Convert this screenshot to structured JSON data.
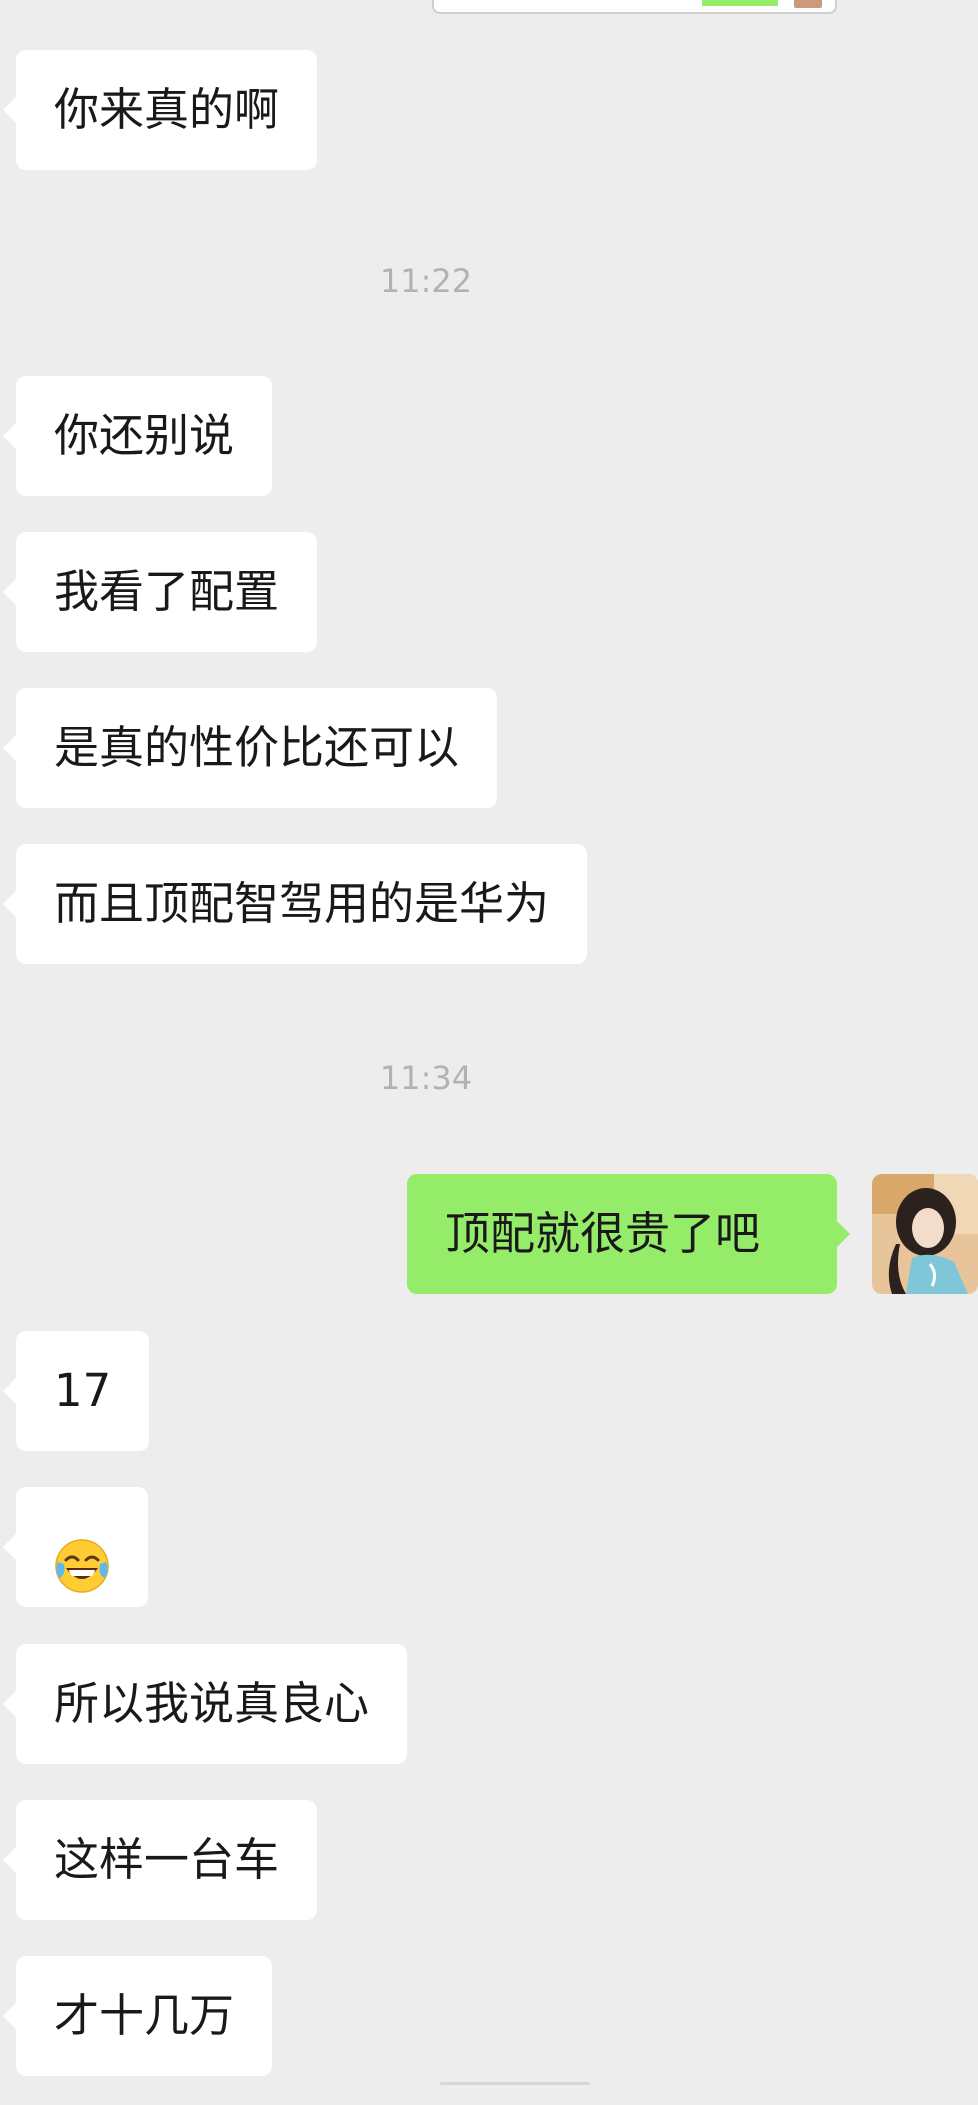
{
  "messages": {
    "m1": "你来真的啊",
    "time1": "11:22",
    "m2": "你还别说",
    "m3": "我看了配置",
    "m4": "是真的性价比还可以",
    "m5": "而且顶配智驾用的是华为",
    "time2": "11:34",
    "m6": "顶配就很贵了吧",
    "m7": "17",
    "m8_emoji": "tears-of-joy-emoji",
    "m9": "所以我说真良心",
    "m10": "这样一台车",
    "m11": "才十几万"
  },
  "colors": {
    "background": "#ededed",
    "incoming_bubble": "#ffffff",
    "outgoing_bubble": "#95ec69",
    "timestamp_text": "#b2b2b2"
  }
}
